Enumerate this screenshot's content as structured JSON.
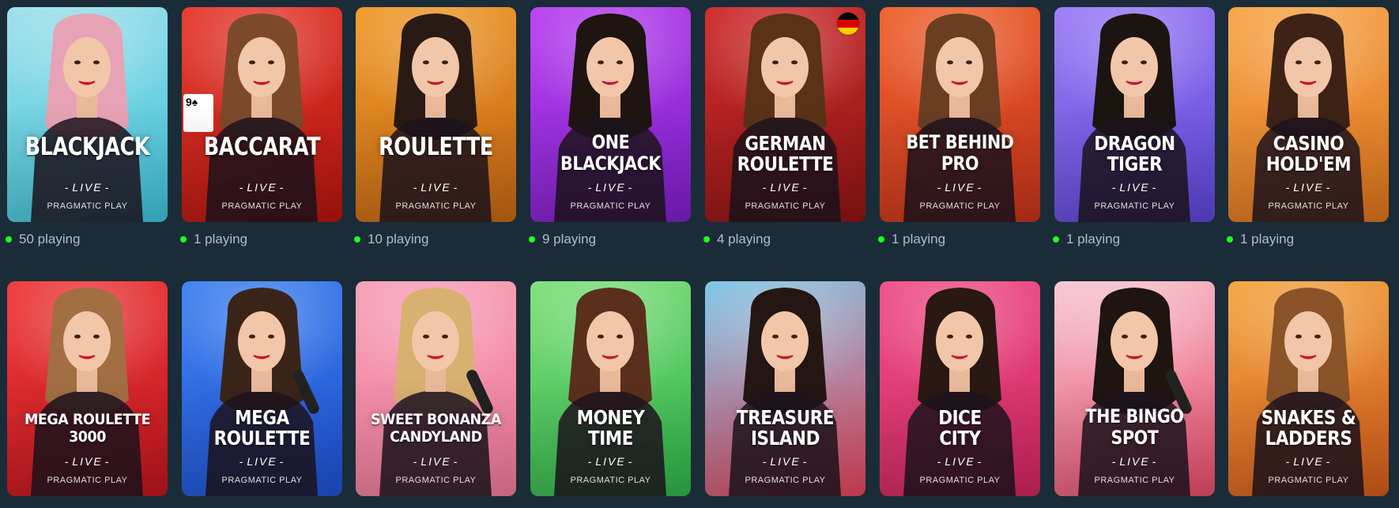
{
  "provider": "PRAGMATIC PLAY",
  "live_label": "LIVE",
  "games": [
    {
      "title": "BLACKJACK",
      "playing": "50 playing",
      "colors": [
        "#9fe0ea",
        "#3cc3da"
      ],
      "hair": "#e7a3b6"
    },
    {
      "title": "BACCARAT",
      "playing": "1 playing",
      "colors": [
        "#e73a2e",
        "#b5150d"
      ],
      "hair": "#7c4a2a"
    },
    {
      "title": "ROULETTE",
      "playing": "10 playing",
      "colors": [
        "#ef9b2a",
        "#c66613"
      ],
      "hair": "#2a1a14"
    },
    {
      "title": "ONE\nBLACKJACK",
      "playing": "9 playing",
      "colors": [
        "#b840f0",
        "#7d1ec9"
      ],
      "hair": "#1e1410"
    },
    {
      "title": "GERMAN\nROULETTE",
      "playing": "4 playing",
      "colors": [
        "#cf2b2b",
        "#8f1414"
      ],
      "hair": "#5a3218",
      "flag": true
    },
    {
      "title": "BET BEHIND\nPRO",
      "playing": "1 playing",
      "colors": [
        "#f0622d",
        "#c5321a"
      ],
      "hair": "#6b3e22"
    },
    {
      "title": "DRAGON\nTIGER",
      "playing": "1 playing",
      "colors": [
        "#9b7cf6",
        "#5d45d8"
      ],
      "hair": "#1c1410"
    },
    {
      "title": "CASINO\nHOLD'EM",
      "playing": "1 playing",
      "colors": [
        "#f7a64a",
        "#e0741c"
      ],
      "hair": "#3e2216"
    },
    {
      "title": "MEGA ROULETTE\n3000",
      "colors": [
        "#f03a3a",
        "#c0151d"
      ],
      "hair": "#a26e42"
    },
    {
      "title": "MEGA\nROULETTE",
      "colors": [
        "#3f82f0",
        "#1e50d2"
      ],
      "hair": "#3a2418"
    },
    {
      "title": "SWEET BONANZA\nCANDYLAND",
      "colors": [
        "#f7a0b8",
        "#f07a9a"
      ],
      "hair": "#d8b070"
    },
    {
      "title": "MONEY\nTIME",
      "colors": [
        "#7ee07a",
        "#2fb34a"
      ],
      "hair": "#5a301c"
    },
    {
      "title": "TREASURE\nISLAND",
      "colors": [
        "#7cc6e8",
        "#e8445a"
      ],
      "hair": "#241612"
    },
    {
      "title": "DICE\nCITY",
      "colors": [
        "#f0508a",
        "#d0245e"
      ],
      "hair": "#2a1812"
    },
    {
      "title": "THE BINGO\nSPOT",
      "colors": [
        "#f8c8d4",
        "#e84a6a"
      ],
      "hair": "#1e1410"
    },
    {
      "title": "SNAKES &\nLADDERS",
      "colors": [
        "#f3a640",
        "#d35a1a"
      ],
      "hair": "#8a5428"
    }
  ],
  "flag_colors": [
    "#000000",
    "#dd0000",
    "#ffce00"
  ],
  "icons": {
    "status_dot": "green-dot-icon",
    "flag": "germany-flag-icon"
  }
}
